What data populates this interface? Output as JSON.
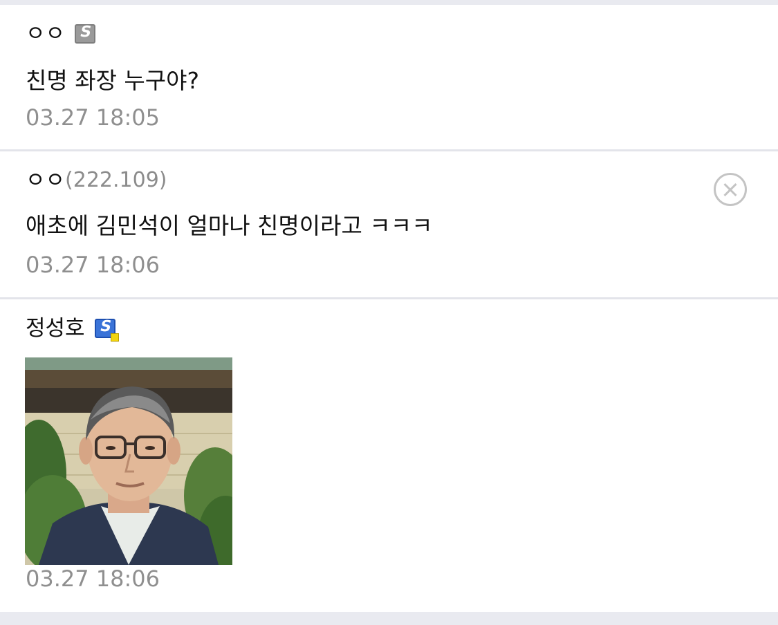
{
  "comments": [
    {
      "author": "ㅇㅇ",
      "badge_icon": "gallery-gonik-icon-gray",
      "text": "친명 좌장 누구야?",
      "time": "03.27 18:05"
    },
    {
      "author": "ㅇㅇ",
      "ip": "(222.109)",
      "text": "애초에 김민석이 얼마나 친명이라고 ㅋㅋㅋ",
      "time": "03.27 18:06",
      "delete_icon": "close-circle-icon"
    },
    {
      "author": "정성호",
      "badge_icon": "gallery-fixed-nick-icon-blue",
      "image": "profile-photo-of-man-with-glasses",
      "time": "03.27 18:06"
    }
  ],
  "colors": {
    "separator": "#e9eaf0",
    "meta_text": "#8f8f8f",
    "badge_blue": "#3a73d8",
    "badge_gray": "#9a9a9a"
  }
}
